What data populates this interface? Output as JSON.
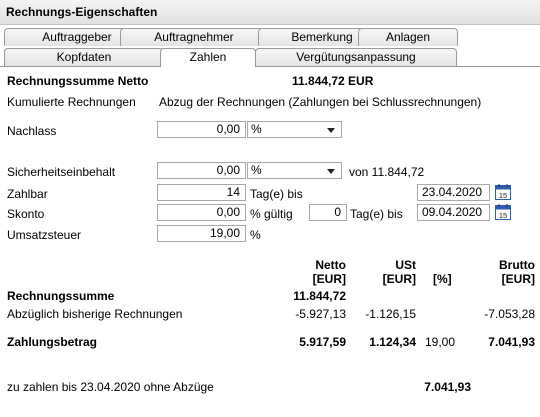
{
  "window": {
    "title": "Rechnungs-Eigenschaften"
  },
  "tabs_row1": [
    "Auftraggeber",
    "Auftragnehmer",
    "Bemerkung",
    "Anlagen"
  ],
  "tabs_row2": [
    "Kopfdaten",
    "Zahlen",
    "Vergütungsanpassung"
  ],
  "active_tab": "Zahlen",
  "summary": {
    "label": "Rechnungssumme Netto",
    "value": "11.844,72 EUR",
    "cumulative_label": "Kumulierte Rechnungen",
    "cumulative_value": "Abzug der Rechnungen (Zahlungen bei Schlussrechnungen)"
  },
  "form": {
    "nachlass_label": "Nachlass",
    "nachlass_value": "0,00",
    "nachlass_unit": "%",
    "sicherheit_label": "Sicherheitseinbehalt",
    "sicherheit_value": "0,00",
    "sicherheit_unit": "%",
    "sicherheit_of": "von 11.844,72",
    "zahlbar_label": "Zahlbar",
    "zahlbar_days": "14",
    "zahlbar_suffix": "Tag(e) bis",
    "zahlbar_date": "23.04.2020",
    "skonto_label": "Skonto",
    "skonto_value": "0,00",
    "skonto_suffix": "% gültig",
    "skonto_days": "0",
    "skonto_days_suffix": "Tag(e) bis",
    "skonto_date": "09.04.2020",
    "ust_label": "Umsatzsteuer",
    "ust_value": "19,00",
    "ust_unit": "%",
    "calendar_day": "15"
  },
  "table": {
    "headers": {
      "netto": "Netto",
      "netto_unit": "[EUR]",
      "ust": "USt",
      "ust_unit": "[EUR]",
      "percent": "[%]",
      "brutto": "Brutto",
      "brutto_unit": "[EUR]"
    },
    "rows": [
      {
        "label": "Rechnungssumme",
        "netto": "11.844,72",
        "ust": "",
        "percent": "",
        "brutto": "",
        "bold": true
      },
      {
        "label": "Abzüglich bisherige Rechnungen",
        "netto": "-5.927,13",
        "ust": "-1.126,15",
        "percent": "",
        "brutto": "-7.053,28",
        "bold": false
      },
      {
        "label": "Zahlungsbetrag",
        "netto": "5.917,59",
        "ust": "1.124,34",
        "percent": "19,00",
        "brutto": "7.041,93",
        "bold": true
      }
    ]
  },
  "footer": {
    "label": "zu zahlen bis 23.04.2020 ohne Abzüge",
    "value": "7.041,93"
  },
  "colors": {
    "tab_border": "#9a9a9a",
    "title_bg": "#e8e8e8",
    "calendar_blue": "#2a5db0"
  }
}
